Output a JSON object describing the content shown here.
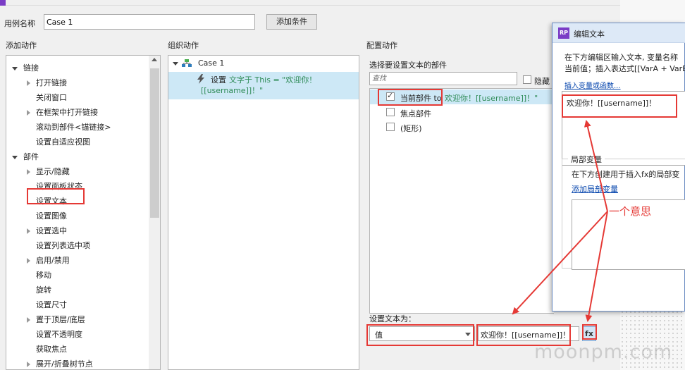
{
  "case_name": {
    "label": "用例名称",
    "value": "Case 1"
  },
  "add_condition_label": "添加条件",
  "sections": {
    "add_action": "添加动作",
    "organize_action": "组织动作",
    "configure_action": "配置动作"
  },
  "action_tree": [
    {
      "label": "链接",
      "level": 0,
      "expander": "open"
    },
    {
      "label": "打开链接",
      "level": 1,
      "expander": "closed"
    },
    {
      "label": "关闭窗口",
      "level": 1,
      "expander": "none"
    },
    {
      "label": "在框架中打开链接",
      "level": 1,
      "expander": "closed"
    },
    {
      "label": "滚动到部件<锚链接>",
      "level": 1,
      "expander": "none"
    },
    {
      "label": "设置自适应视图",
      "level": 1,
      "expander": "none"
    },
    {
      "label": "部件",
      "level": 0,
      "expander": "open"
    },
    {
      "label": "显示/隐藏",
      "level": 1,
      "expander": "closed"
    },
    {
      "label": "设置面板状态",
      "level": 1,
      "expander": "none"
    },
    {
      "label": "设置文本",
      "level": 1,
      "expander": "none",
      "highlighted": true
    },
    {
      "label": "设置图像",
      "level": 1,
      "expander": "none"
    },
    {
      "label": "设置选中",
      "level": 1,
      "expander": "closed"
    },
    {
      "label": "设置列表选中项",
      "level": 1,
      "expander": "none"
    },
    {
      "label": "启用/禁用",
      "level": 1,
      "expander": "closed"
    },
    {
      "label": "移动",
      "level": 1,
      "expander": "none"
    },
    {
      "label": "旋转",
      "level": 1,
      "expander": "none"
    },
    {
      "label": "设置尺寸",
      "level": 1,
      "expander": "none"
    },
    {
      "label": "置于顶层/底层",
      "level": 1,
      "expander": "closed"
    },
    {
      "label": "设置不透明度",
      "level": 1,
      "expander": "none"
    },
    {
      "label": "获取焦点",
      "level": 1,
      "expander": "none"
    },
    {
      "label": "展开/折叠树节点",
      "level": 1,
      "expander": "closed"
    }
  ],
  "organize": {
    "case_label": "Case 1",
    "action_prefix": "设置",
    "action_detail_line1": "文字于 This = \"欢迎你！",
    "action_detail_line2": "[[username]]！\""
  },
  "configure": {
    "select_widget_label": "选择要设置文本的部件",
    "search_placeholder": "查找",
    "hide_label": "隐藏",
    "widgets": [
      {
        "label": "当前部件 to",
        "value": "欢迎你！[[username]]！\"",
        "checked": true
      },
      {
        "label": "焦点部件",
        "value": "",
        "checked": false
      },
      {
        "label": "(矩形)",
        "value": "",
        "checked": false
      }
    ],
    "set_text_label": "设置文本为：",
    "type_select": "值",
    "text_value": "欢迎你！[[username]]！",
    "fx_label": "fx"
  },
  "edit_dialog": {
    "app_badge": "RP",
    "title": "编辑文本",
    "instructions_line1": "在下方编辑区输入文本, 变量名称",
    "instructions_line2": "当前值；插入表达式[[VarA + VarB",
    "insert_link": "插入变量或函数...",
    "editor_text": "欢迎你！[[username]]！",
    "local_vars_heading": "局部变量",
    "local_vars_desc": "在下方创建用于插入fx的局部变",
    "add_local_var_link": "添加局部变量"
  },
  "annotation": "一个意思",
  "watermark": "moonpm.com",
  "colors": {
    "highlight_row": "#cde8f6",
    "red": "#e53935",
    "green_text": "#2e8b57",
    "link": "#0645ad"
  }
}
